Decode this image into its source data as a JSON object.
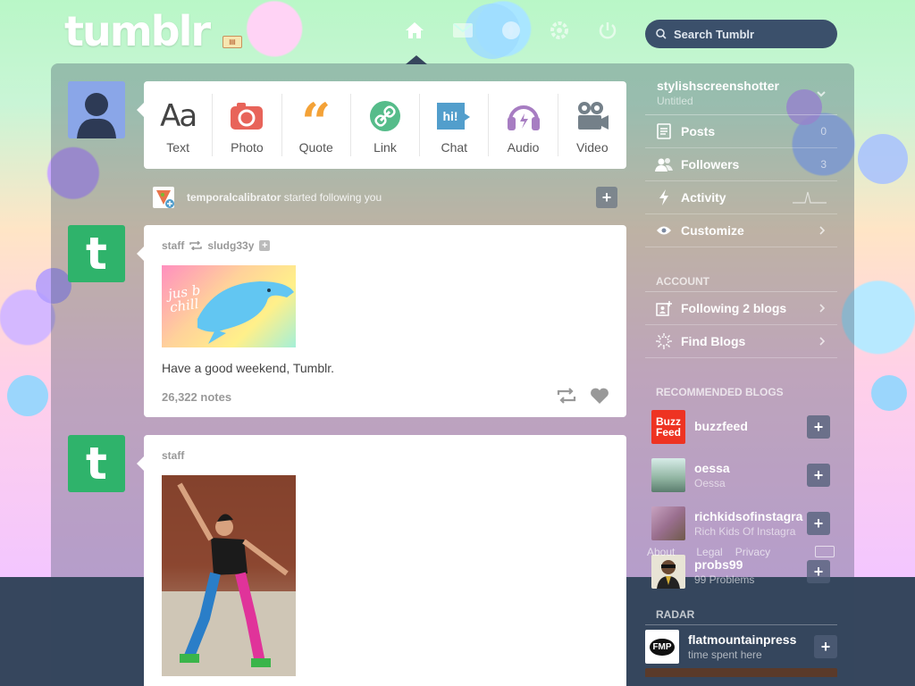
{
  "header": {
    "logo": "tumblr",
    "search_placeholder": "Search Tumblr",
    "nav_icons": [
      "home-icon",
      "mail-icon",
      "compass-icon",
      "gear-icon",
      "power-icon"
    ]
  },
  "post_box": {
    "items": [
      {
        "label": "Text",
        "icon": "text-icon"
      },
      {
        "label": "Photo",
        "icon": "camera-icon"
      },
      {
        "label": "Quote",
        "icon": "quote-icon"
      },
      {
        "label": "Link",
        "icon": "link-icon"
      },
      {
        "label": "Chat",
        "icon": "chat-icon"
      },
      {
        "label": "Audio",
        "icon": "headphones-icon"
      },
      {
        "label": "Video",
        "icon": "video-camera-icon"
      }
    ]
  },
  "notification": {
    "user": "temporalcalibrator",
    "text": "started following you"
  },
  "posts": [
    {
      "blog": "staff",
      "reblogged_from": "sludg33y",
      "image_text": "jus b chill",
      "caption": "Have a good weekend, Tumblr.",
      "notes": "26,322 notes"
    },
    {
      "blog": "staff"
    }
  ],
  "sidebar": {
    "blog_name": "stylishscreenshotter",
    "blog_title": "Untitled",
    "items": [
      {
        "label": "Posts",
        "count": "0",
        "icon": "posts-icon"
      },
      {
        "label": "Followers",
        "count": "3",
        "icon": "followers-icon"
      },
      {
        "label": "Activity",
        "icon": "lightning-icon"
      },
      {
        "label": "Customize",
        "icon": "eye-icon"
      }
    ],
    "account_heading": "ACCOUNT",
    "account_items": [
      {
        "label": "Following 2 blogs",
        "icon": "following-icon"
      },
      {
        "label": "Find Blogs",
        "icon": "sparkle-icon"
      }
    ],
    "recommended_heading": "RECOMMENDED BLOGS",
    "recommended": [
      {
        "name": "buzzfeed",
        "sub": "",
        "thumb_text": "Buzz Feed",
        "color": "#ee3322"
      },
      {
        "name": "oessa",
        "sub": "Oessa",
        "thumb_text": "",
        "color": "#8fb3a0"
      },
      {
        "name": "richkidsofinstagra",
        "sub": "Rich Kids Of Instagra",
        "thumb_text": "",
        "color": "#9a6f8f"
      },
      {
        "name": "probs99",
        "sub": "99 Problems",
        "thumb_text": "",
        "color": "#e8e4d5"
      }
    ],
    "footer": {
      "about": "About",
      "legal": "Legal",
      "privacy": "Privacy"
    },
    "radar_heading": "RADAR",
    "radar": {
      "name": "flatmountainpress",
      "sub": "time spent here",
      "thumb_text": "FMP"
    }
  },
  "colors": {
    "navy": "#36465d",
    "tumblr_green": "#2fb36b",
    "photo": "#e8645a",
    "quote": "#f4a237",
    "link": "#56bc8a",
    "chat": "#529ecc",
    "audio": "#a77dc2",
    "video": "#748089"
  }
}
